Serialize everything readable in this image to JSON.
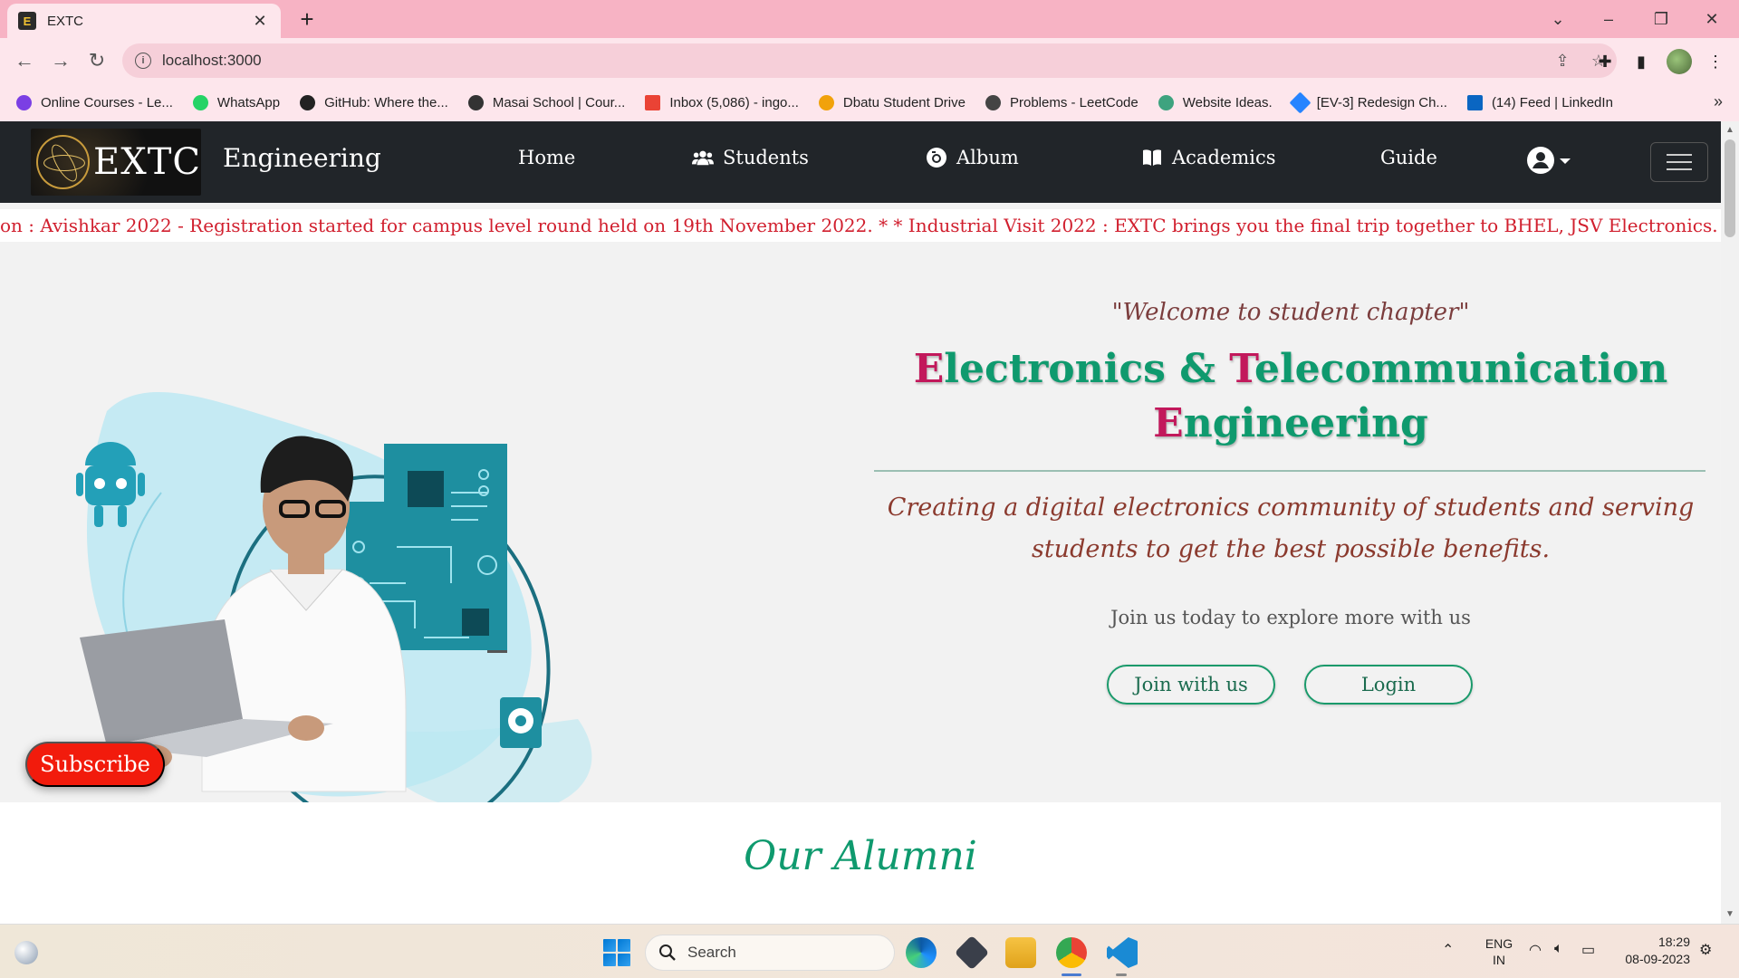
{
  "browser": {
    "tab_title": "EXTC",
    "tab_favicon": "E",
    "url": "localhost:3000",
    "bookmarks": [
      {
        "label": "Online Courses - Le...",
        "color": "#7b3fe4"
      },
      {
        "label": "WhatsApp",
        "color": "#25d366"
      },
      {
        "label": "GitHub: Where the...",
        "color": "#222222"
      },
      {
        "label": "Masai School | Cour...",
        "color": "#333333"
      },
      {
        "label": "Inbox (5,086) - ingo...",
        "color": "#ea4335"
      },
      {
        "label": "Dbatu Student Drive",
        "color": "#f1a20b"
      },
      {
        "label": "Problems - LeetCode",
        "color": "#444444"
      },
      {
        "label": "Website Ideas.",
        "color": "#3ea37f"
      },
      {
        "label": "[EV-3] Redesign Ch...",
        "color": "#2684ff"
      },
      {
        "label": "(14) Feed | LinkedIn",
        "color": "#0a66c2"
      }
    ]
  },
  "navbar": {
    "logo_text": "EXTC",
    "brand": "Engineering",
    "items": [
      {
        "label": "Home",
        "icon": ""
      },
      {
        "label": "Students",
        "icon": "users-icon"
      },
      {
        "label": "Album",
        "icon": "camera-icon"
      },
      {
        "label": "Academics",
        "icon": "book-icon"
      },
      {
        "label": "Guide",
        "icon": ""
      }
    ]
  },
  "marquee": "on : Avishkar 2022 - Registration started for campus level round held on 19th November 2022. * * Industrial Visit 2022 : EXTC brings you the final trip together to BHEL, JSV Electronics. *",
  "hero": {
    "welcome": "\"Welcome to student chapter\"",
    "title_line1_cap1": "E",
    "title_line1_rest1": "lectronics & ",
    "title_line1_cap2": "T",
    "title_line1_rest2": "elecommunication",
    "title_line2_cap": "E",
    "title_line2_rest": "ngineering",
    "tagline": "Creating a digital electronics community of students and serving students to get the best possible benefits.",
    "join_text": "Join us today to explore more with us",
    "join_button": "Join with us",
    "login_button": "Login",
    "subscribe_button": "Subscribe"
  },
  "alumni": {
    "title": "Our Alumni"
  },
  "taskbar": {
    "search_placeholder": "Search",
    "lang_line1": "ENG",
    "lang_line2": "IN",
    "time": "18:29",
    "date": "08-09-2023"
  },
  "colors": {
    "navbar_bg": "#212529",
    "accent_green": "#0f9a6e",
    "accent_pink": "#c2185b",
    "marquee_red": "#d11f2e",
    "subscribe_red": "#f21b0c",
    "chrome_pink": "#f7b3c4"
  }
}
